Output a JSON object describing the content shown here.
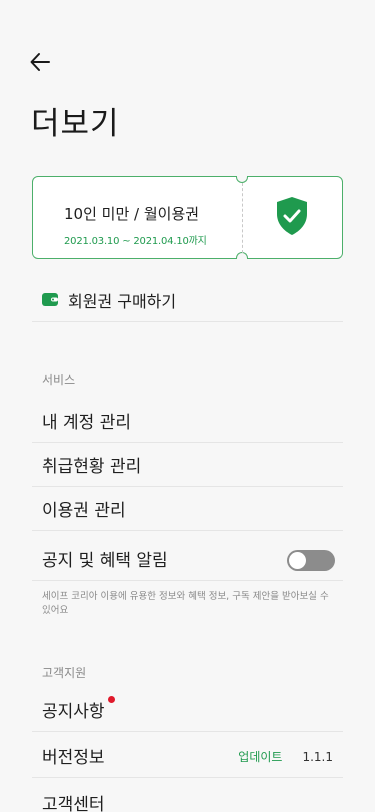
{
  "header": {
    "back_icon": "arrow-left-icon",
    "title": "더보기"
  },
  "ticket": {
    "title": "10인 미만 / 월이용권",
    "period": "2021.03.10 ~ 2021.04.10까지",
    "icon": "shield-check-icon",
    "accent_color": "#1f9a4e"
  },
  "purchase": {
    "icon": "wallet-icon",
    "label": "회원권 구매하기"
  },
  "services": {
    "header": "서비스",
    "items": [
      {
        "label": "내 계정 관리"
      },
      {
        "label": "취급현황 관리"
      },
      {
        "label": "이용권 관리"
      }
    ],
    "notification": {
      "label": "공지 및 혜택 알림",
      "enabled": false,
      "description": "세이프 코리아 이용에 유용한 정보와 혜택 정보, 구독 제안을 받아보실 수 있어요"
    }
  },
  "support": {
    "header": "고객지원",
    "notice_label": "공지사항",
    "notice_has_new": true,
    "version_label": "버전정보",
    "update_label": "업데이트",
    "version_number": "1.1.1",
    "customer_center_label": "고객센터"
  }
}
